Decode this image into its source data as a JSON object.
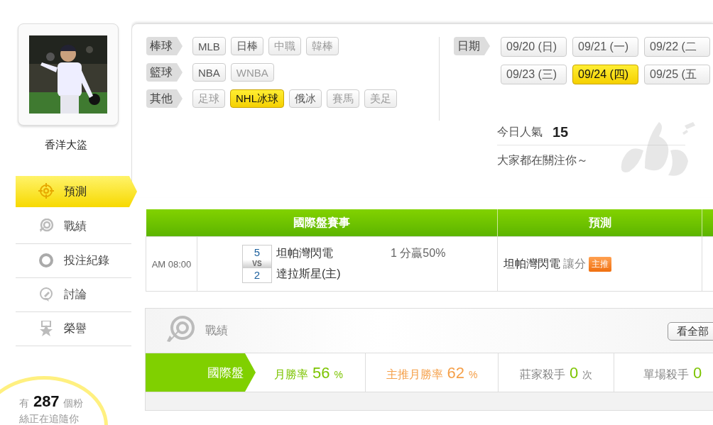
{
  "profile": {
    "name": "香洋大盜"
  },
  "menu": [
    {
      "label": "預測",
      "selected": true
    },
    {
      "label": "戰績",
      "selected": false
    },
    {
      "label": "投注紀錄",
      "selected": false
    },
    {
      "label": "討論",
      "selected": false
    },
    {
      "label": "榮譽",
      "selected": false
    }
  ],
  "fans": {
    "text": "有 **287** 個粉絲正在追隨你"
  },
  "filters": [
    {
      "label": "棒球",
      "options": [
        {
          "label": "MLB",
          "disabled": false,
          "selected": false
        },
        {
          "label": "日棒",
          "disabled": false,
          "selected": false
        },
        {
          "label": "中職",
          "disabled": true,
          "selected": false
        },
        {
          "label": "韓棒",
          "disabled": true,
          "selected": false
        }
      ]
    },
    {
      "label": "籃球",
      "options": [
        {
          "label": "NBA",
          "disabled": false,
          "selected": false
        },
        {
          "label": "WNBA",
          "disabled": true,
          "selected": false
        }
      ]
    },
    {
      "label": "其他",
      "options": [
        {
          "label": "足球",
          "disabled": true,
          "selected": false
        },
        {
          "label": "NHL冰球",
          "disabled": false,
          "selected": true
        },
        {
          "label": "俄冰",
          "disabled": false,
          "selected": false
        },
        {
          "label": "賽馬",
          "disabled": true,
          "selected": false
        },
        {
          "label": "美足",
          "disabled": true,
          "selected": false
        }
      ]
    }
  ],
  "dates": {
    "label": "日期",
    "options": [
      {
        "label": "09/20 (日)",
        "selected": false
      },
      {
        "label": "09/21 (一)",
        "selected": false
      },
      {
        "label": "09/22 (二",
        "selected": false
      },
      {
        "label": "09/23 (三)",
        "selected": false
      },
      {
        "label": "09/24 (四)",
        "selected": true
      },
      {
        "label": "09/25 (五",
        "selected": false
      }
    ]
  },
  "popularity": {
    "label": "今日人氣",
    "value": "15",
    "message": "大家都在關注你～"
  },
  "table": {
    "columns": [
      "國際盤賽事",
      "預測"
    ],
    "rows": [
      {
        "time": "AM 08:00",
        "score_1": "5",
        "vs": "VS",
        "score_2": "2",
        "team_1": "坦帕灣閃電",
        "team_2": "達拉斯星(主)",
        "odds": "1 分贏50%",
        "pick_team": "坦帕灣閃電",
        "pick_type": "讓分",
        "pick_badge": "主推"
      }
    ]
  },
  "record": {
    "title": "戰績",
    "view_all": "看全部",
    "category": "國際盤",
    "stats": [
      {
        "kind": "rate",
        "label": "月勝率",
        "value": "56",
        "unit": "%",
        "color": "#7cc400"
      },
      {
        "kind": "rate",
        "label": "主推月勝率",
        "value": "62",
        "unit": "%",
        "color": "#f5a04a"
      },
      {
        "kind": "count",
        "label": "莊家殺手",
        "value": "0",
        "unit": "次",
        "color": "#7cc400"
      },
      {
        "kind": "count",
        "label": "單場殺手",
        "value": "0",
        "color": "#7cc400"
      }
    ]
  }
}
